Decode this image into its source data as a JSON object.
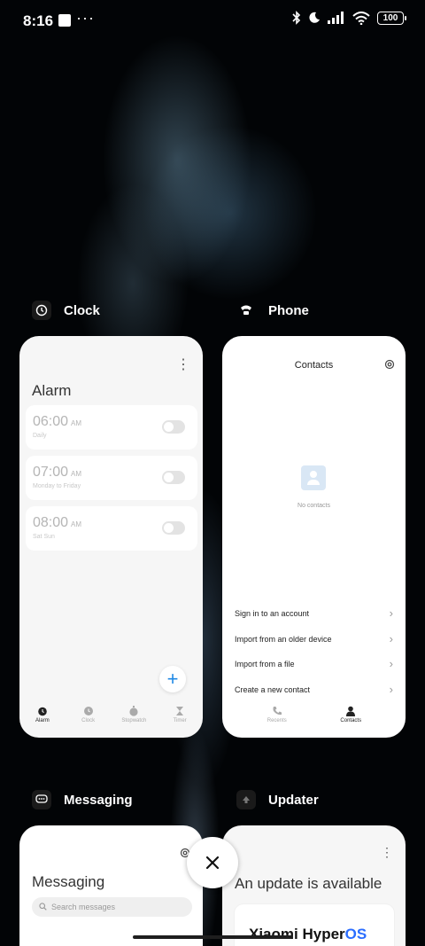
{
  "status_bar": {
    "time": "8:16",
    "dots": "···",
    "battery": "100"
  },
  "apps": [
    {
      "name": "Clock",
      "icon": "clock-icon"
    },
    {
      "name": "Phone",
      "icon": "phone-app-icon"
    },
    {
      "name": "Messaging",
      "icon": "messaging-icon"
    },
    {
      "name": "Updater",
      "icon": "updater-icon"
    }
  ],
  "clock_card": {
    "title": "Alarm",
    "alarms": [
      {
        "time": "06:00",
        "ampm": "AM",
        "repeat": "Daily",
        "enabled": false
      },
      {
        "time": "07:00",
        "ampm": "AM",
        "repeat": "Monday to Friday",
        "enabled": false
      },
      {
        "time": "08:00",
        "ampm": "AM",
        "repeat": "Sat Sun",
        "enabled": false
      }
    ],
    "add_label": "+",
    "tabs": [
      "Alarm",
      "Clock",
      "Stopwatch",
      "Timer"
    ],
    "active_tab": "Alarm"
  },
  "phone_card": {
    "title": "Contacts",
    "empty_text": "No contacts",
    "actions": [
      "Sign in to an account",
      "Import from an older device",
      "Import from a file",
      "Create a new contact"
    ],
    "tabs": [
      "Recents",
      "Contacts"
    ],
    "active_tab": "Contacts"
  },
  "messaging_card": {
    "title": "Messaging",
    "search_placeholder": "Search messages"
  },
  "updater_card": {
    "title": "An update is available",
    "brand_primary": "Xiaomi Hyper",
    "brand_accent": "OS"
  },
  "colors": {
    "accent": "#1e88e5",
    "brand_blue": "#2a6dff",
    "card_bg": "#f6f6f6"
  }
}
